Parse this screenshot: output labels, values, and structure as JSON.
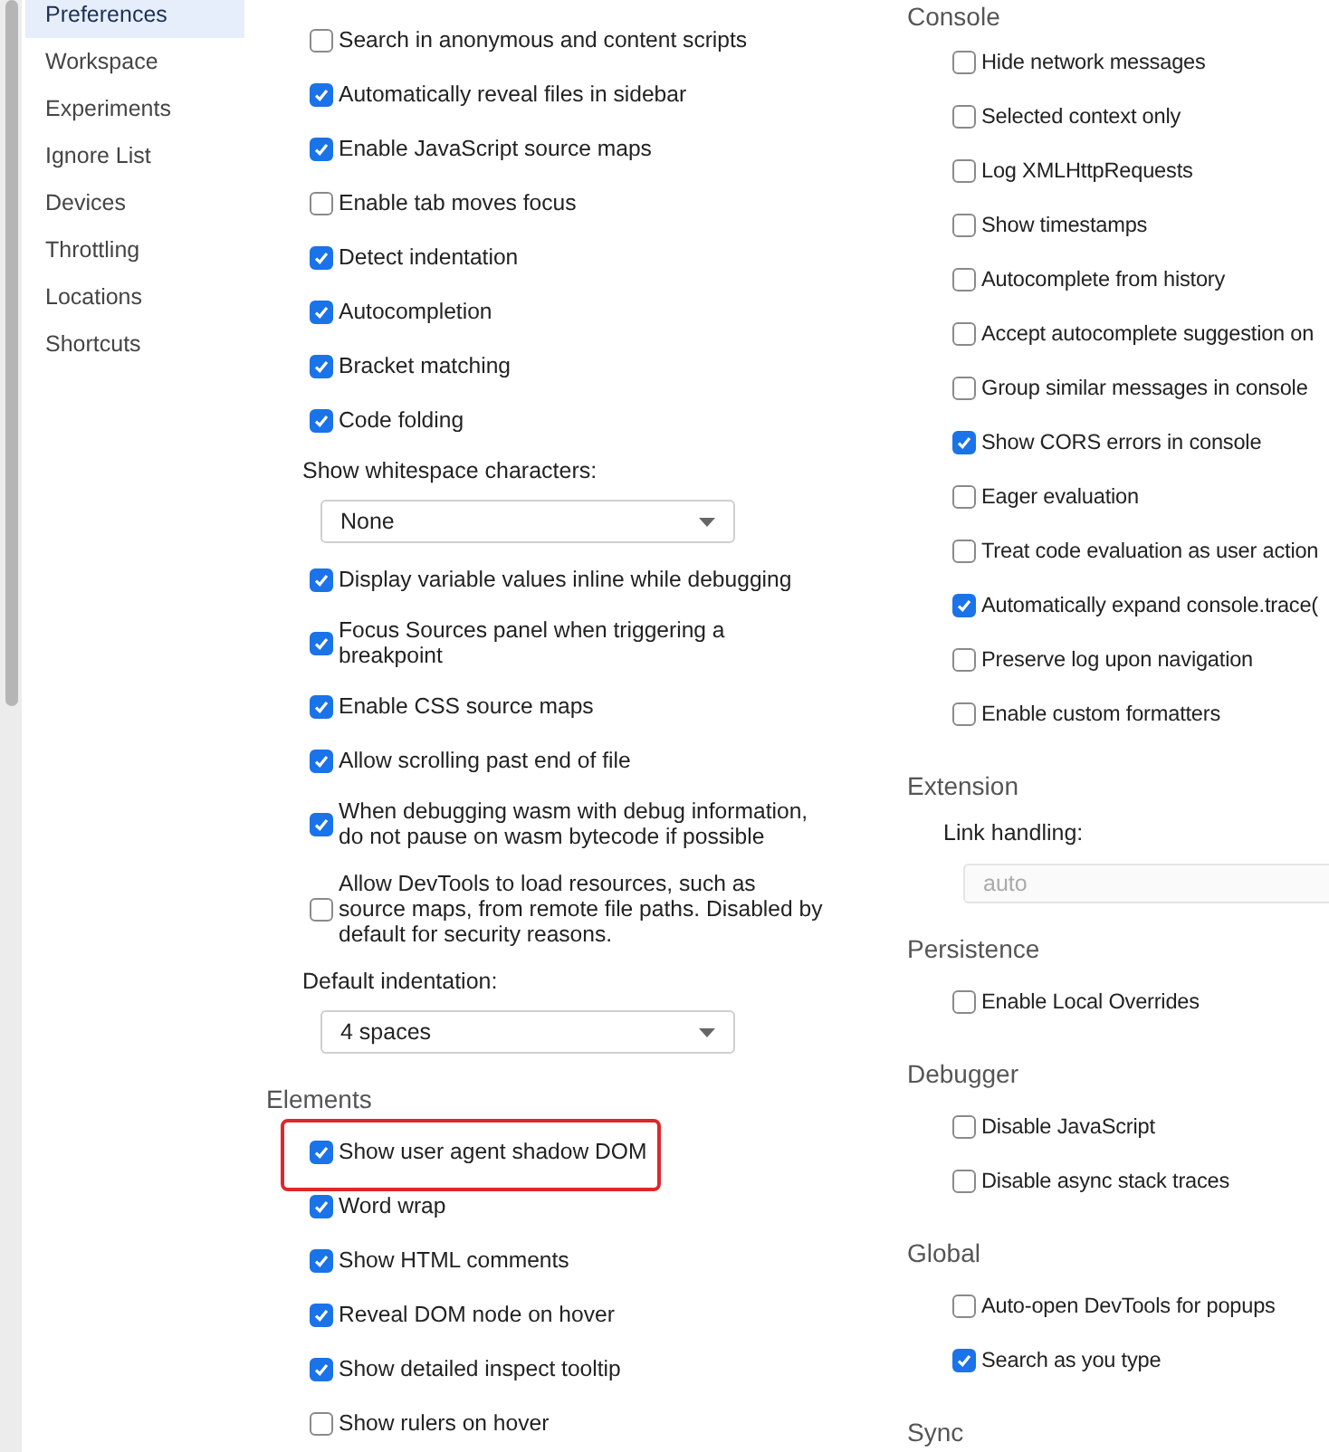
{
  "sidebar": {
    "items": [
      {
        "label": "Preferences",
        "selected": true
      },
      {
        "label": "Workspace",
        "selected": false
      },
      {
        "label": "Experiments",
        "selected": false
      },
      {
        "label": "Ignore List",
        "selected": false
      },
      {
        "label": "Devices",
        "selected": false
      },
      {
        "label": "Throttling",
        "selected": false
      },
      {
        "label": "Locations",
        "selected": false
      },
      {
        "label": "Shortcuts",
        "selected": false
      }
    ]
  },
  "columns": [
    {
      "sections": [
        {
          "items": [
            {
              "kind": "checkbox",
              "label": "Search in anonymous and content scripts",
              "checked": false
            },
            {
              "kind": "checkbox",
              "label": "Automatically reveal files in sidebar",
              "checked": true
            },
            {
              "kind": "checkbox",
              "label": "Enable JavaScript source maps",
              "checked": true
            },
            {
              "kind": "checkbox",
              "label": "Enable tab moves focus",
              "checked": false
            },
            {
              "kind": "checkbox",
              "label": "Detect indentation",
              "checked": true
            },
            {
              "kind": "checkbox",
              "label": "Autocompletion",
              "checked": true
            },
            {
              "kind": "checkbox",
              "label": "Bracket matching",
              "checked": true
            },
            {
              "kind": "checkbox",
              "label": "Code folding",
              "checked": true
            },
            {
              "kind": "label",
              "label": "Show whitespace characters:"
            },
            {
              "kind": "select",
              "value": "None",
              "disabled": false
            },
            {
              "kind": "checkbox",
              "label": "Display variable values inline while debugging",
              "checked": true
            },
            {
              "kind": "checkbox",
              "label": "Focus Sources panel when triggering a breakpoint",
              "checked": true
            },
            {
              "kind": "checkbox",
              "label": "Enable CSS source maps",
              "checked": true
            },
            {
              "kind": "checkbox",
              "label": "Allow scrolling past end of file",
              "checked": true
            },
            {
              "kind": "checkbox",
              "label": "When debugging wasm with debug information, do not pause on wasm bytecode if possible",
              "checked": true
            },
            {
              "kind": "checkbox",
              "label": "Allow DevTools to load resources, such as source maps, from remote file paths. Disabled by default for security reasons.",
              "checked": false
            },
            {
              "kind": "label",
              "label": "Default indentation:"
            },
            {
              "kind": "select",
              "value": "4 spaces",
              "disabled": false
            }
          ]
        },
        {
          "title": "Elements",
          "items": [
            {
              "kind": "checkbox",
              "label": "Show user agent shadow DOM",
              "checked": true,
              "highlighted": true
            },
            {
              "kind": "checkbox",
              "label": "Word wrap",
              "checked": true,
              "highlighted": false
            },
            {
              "kind": "checkbox",
              "label": "Show HTML comments",
              "checked": true,
              "highlighted": false
            },
            {
              "kind": "checkbox",
              "label": "Reveal DOM node on hover",
              "checked": true,
              "highlighted": false
            },
            {
              "kind": "checkbox",
              "label": "Show detailed inspect tooltip",
              "checked": true,
              "highlighted": false
            },
            {
              "kind": "checkbox",
              "label": "Show rulers on hover",
              "checked": false,
              "highlighted": false
            }
          ]
        }
      ]
    },
    {
      "sections": [
        {
          "title": "Console",
          "items": [
            {
              "kind": "checkbox",
              "label": "Hide network messages",
              "checked": false
            },
            {
              "kind": "checkbox",
              "label": "Selected context only",
              "checked": false
            },
            {
              "kind": "checkbox",
              "label": "Log XMLHttpRequests",
              "checked": false
            },
            {
              "kind": "checkbox",
              "label": "Show timestamps",
              "checked": false
            },
            {
              "kind": "checkbox",
              "label": "Autocomplete from history",
              "checked": false
            },
            {
              "kind": "checkbox",
              "label": "Accept autocomplete suggestion on",
              "checked": false
            },
            {
              "kind": "checkbox",
              "label": "Group similar messages in console",
              "checked": false
            },
            {
              "kind": "checkbox",
              "label": "Show CORS errors in console",
              "checked": true
            },
            {
              "kind": "checkbox",
              "label": "Eager evaluation",
              "checked": false
            },
            {
              "kind": "checkbox",
              "label": "Treat code evaluation as user action",
              "checked": false
            },
            {
              "kind": "checkbox",
              "label": "Automatically expand console.trace(",
              "checked": true
            },
            {
              "kind": "checkbox",
              "label": "Preserve log upon navigation",
              "checked": false
            },
            {
              "kind": "checkbox",
              "label": "Enable custom formatters",
              "checked": false
            }
          ]
        },
        {
          "title": "Extension",
          "items": [
            {
              "kind": "label",
              "label": "Link handling:"
            },
            {
              "kind": "select",
              "value": "auto",
              "disabled": true
            }
          ]
        },
        {
          "title": "Persistence",
          "items": [
            {
              "kind": "checkbox",
              "label": "Enable Local Overrides",
              "checked": false
            }
          ]
        },
        {
          "title": "Debugger",
          "items": [
            {
              "kind": "checkbox",
              "label": "Disable JavaScript",
              "checked": false
            },
            {
              "kind": "checkbox",
              "label": "Disable async stack traces",
              "checked": false
            }
          ]
        },
        {
          "title": "Global",
          "items": [
            {
              "kind": "checkbox",
              "label": "Auto-open DevTools for popups",
              "checked": false
            },
            {
              "kind": "checkbox",
              "label": "Search as you type",
              "checked": true
            }
          ]
        },
        {
          "title": "Sync"
        }
      ]
    }
  ]
}
